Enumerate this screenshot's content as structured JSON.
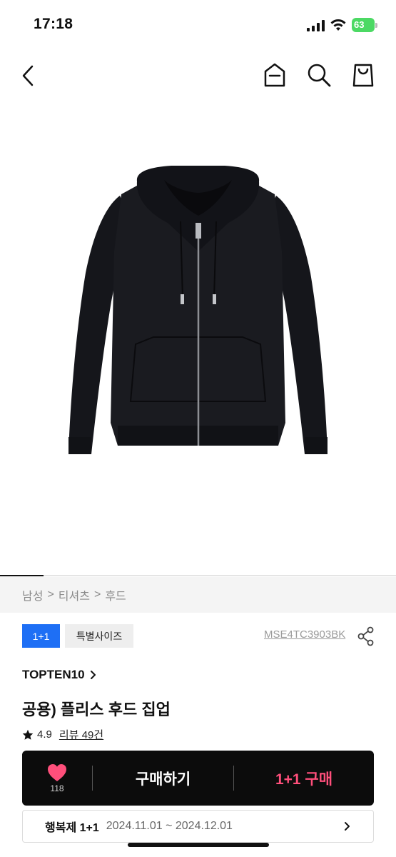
{
  "status_bar": {
    "time": "17:18",
    "battery_level": "63",
    "icons": [
      "signal-icon",
      "wifi-icon",
      "battery-charging-icon"
    ]
  },
  "nav": {
    "icons": [
      "back-chevron-icon",
      "home-icon",
      "search-icon",
      "shopping-bag-icon"
    ]
  },
  "gallery": {
    "current_index_fraction": 0.11
  },
  "breadcrumb": {
    "items": [
      "남성",
      "티셔츠",
      "후드"
    ],
    "separator": ">"
  },
  "tags": {
    "promo_tag": "1+1",
    "size_tag": "특별사이즈"
  },
  "product": {
    "code": "MSE4TC3903BK",
    "brand": "TOPTEN10",
    "name": "공용) 플리스 후드 집업",
    "rating": "4.9",
    "review_label": "리뷰 49건"
  },
  "actions": {
    "like_count": "118",
    "buy_label": "구매하기",
    "plus_buy_label": "1+1 구매"
  },
  "promotion": {
    "title": "행복제 1+1",
    "dates": "2024.11.01 ~ 2024.12.01"
  },
  "colors": {
    "accent_blue": "#1e6ff5",
    "accent_pink": "#ff4f7b",
    "buy_bar_bg": "#0c0c0c",
    "battery_green": "#4cd964"
  }
}
